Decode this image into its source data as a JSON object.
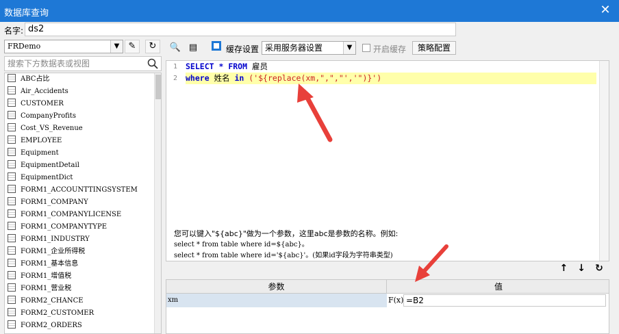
{
  "window": {
    "title": "数据库查询",
    "close_glyph": "✕"
  },
  "name_field": {
    "label": "名字:",
    "value": "ds2"
  },
  "datasource": {
    "selected": "FRDemo"
  },
  "search": {
    "placeholder": "搜索下方数据表或视图"
  },
  "tables": [
    "ABC占比",
    "Air_Accidents",
    "CUSTOMER",
    "CompanyProfits",
    "Cost_VS_Revenue",
    "EMPLOYEE",
    "Equipment",
    "EquipmentDetail",
    "EquipmentDict",
    "FORM1_ACCOUNTTINGSYSTEM",
    "FORM1_COMPANY",
    "FORM1_COMPANYLICENSE",
    "FORM1_COMPANYTYPE",
    "FORM1_INDUSTRY",
    "FORM1_企业所得税",
    "FORM1_基本信息",
    "FORM1_增值税",
    "FORM1_营业税",
    "FORM2_CHANCE",
    "FORM2_CUSTOMER",
    "FORM2_ORDERS"
  ],
  "toolbar": {
    "cache_label": "缓存设置",
    "cache_select": "采用服务器设置",
    "enable_cache": "开启缓存",
    "strategy_button": "策略配置"
  },
  "editor": {
    "line_numbers": [
      "1",
      "2"
    ],
    "line1": {
      "kw1": "SELECT",
      "star": " * ",
      "kw2": "FROM",
      "rest": " 雇员"
    },
    "line2": {
      "kw1": "where",
      "mid": " 姓名 ",
      "kw2": "in",
      "space": " ",
      "expr": "('${replace(xm,\",\",\"','\")}')"
    }
  },
  "help": {
    "line1": "您可以键入\"${abc}\"做为一个参数，这里abc是参数的名称。例如:",
    "line2": "select * from table where id=${abc}。",
    "line3": "select * from table where id='${abc}'。(如果id字段为字符串类型)"
  },
  "actions": {
    "up": "↑",
    "down": "↓",
    "refresh": "↻"
  },
  "params": {
    "col_param": "参数",
    "col_value": "值",
    "rows": [
      {
        "name": "xm",
        "fx": "F(x)",
        "value": "=B2"
      }
    ]
  },
  "colors": {
    "titlebar": "#1e78d6",
    "annotation_arrow": "#e8403a",
    "highlight_line": "#ffffaa"
  }
}
